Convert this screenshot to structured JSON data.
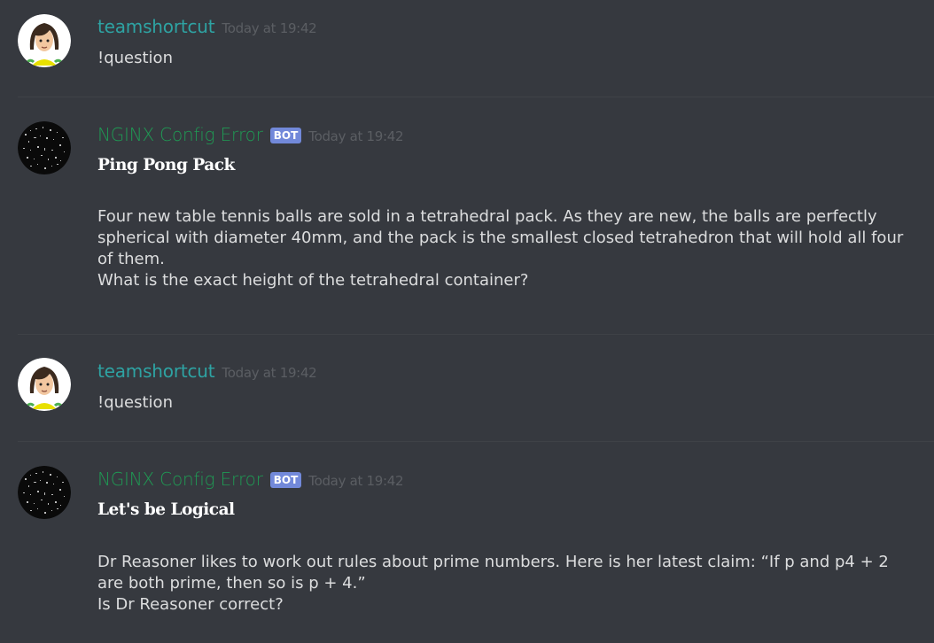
{
  "messages": [
    {
      "author": "teamshortcut",
      "timestamp": "Today at 19:42",
      "content": "!question",
      "avatar_icon": "anime-avatar-icon"
    },
    {
      "author": "NGINX Config Error",
      "bot_tag": "BOT",
      "timestamp": "Today at 19:42",
      "embed_title": "Ping Pong Pack",
      "lines": [
        "Four new table tennis balls are sold in a tetrahedral pack. As they are new, the balls are perfectly",
        "spherical with diameter 40mm, and the pack is the smallest closed tetrahedron that will hold all four",
        "of them.",
        "What is the exact height of the tetrahedral container?"
      ],
      "avatar_icon": "starry-noise-avatar-icon"
    },
    {
      "author": "teamshortcut",
      "timestamp": "Today at 19:42",
      "content": "!question",
      "avatar_icon": "anime-avatar-icon"
    },
    {
      "author": "NGINX Config Error",
      "bot_tag": "BOT",
      "timestamp": "Today at 19:42",
      "embed_title": "Let's be Logical",
      "lines": [
        "Dr Reasoner likes to work out rules about prime numbers. Here is her latest claim: “If p and p4 + 2",
        "are both prime, then so is p + 4.”",
        "Is Dr Reasoner correct?"
      ],
      "avatar_icon": "starry-noise-avatar-icon"
    }
  ],
  "colors": {
    "background": "#36393f",
    "user_name": "#2ea3a3",
    "bot_name": "#1f9a54",
    "bot_tag": "#7289da",
    "text": "#dcddde",
    "timestamp": "#5b5e63"
  }
}
